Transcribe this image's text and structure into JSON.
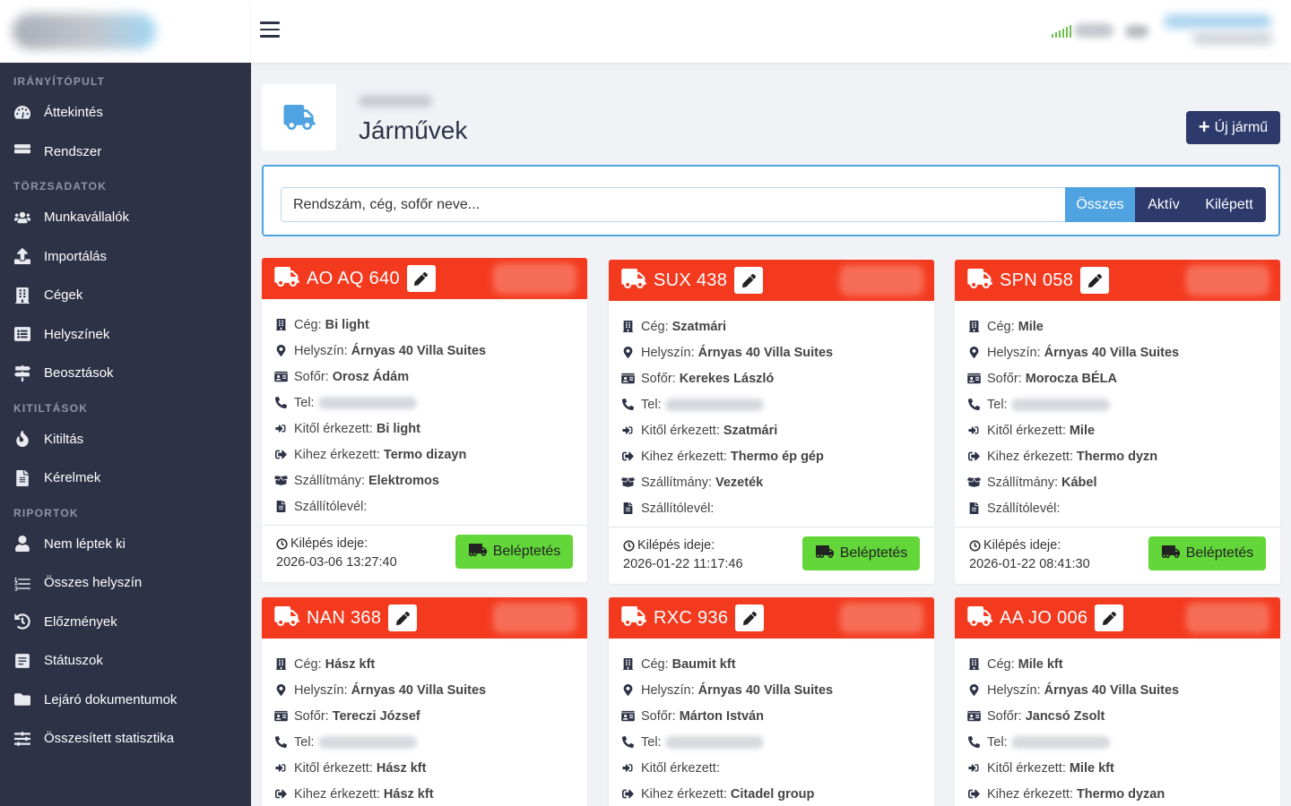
{
  "sidebar": {
    "sections": [
      {
        "title": "IRÁNYÍTÓPULT",
        "items": [
          {
            "label": "Áttekintés",
            "icon": "dashboard-icon"
          },
          {
            "label": "Rendszer",
            "icon": "server-icon"
          }
        ]
      },
      {
        "title": "TÖRZSADATOK",
        "items": [
          {
            "label": "Munkavállalók",
            "icon": "users-icon"
          },
          {
            "label": "Importálás",
            "icon": "upload-icon"
          },
          {
            "label": "Cégek",
            "icon": "building-icon"
          },
          {
            "label": "Helyszínek",
            "icon": "list-icon"
          },
          {
            "label": "Beosztások",
            "icon": "signs-icon"
          }
        ]
      },
      {
        "title": "KITILTÁSOK",
        "items": [
          {
            "label": "Kitiltás",
            "icon": "fire-icon"
          },
          {
            "label": "Kérelmek",
            "icon": "file-icon"
          }
        ]
      },
      {
        "title": "RIPORTOK",
        "items": [
          {
            "label": "Nem léptek ki",
            "icon": "user-report-icon"
          },
          {
            "label": "Összes helyszín",
            "icon": "ordered-list-icon"
          },
          {
            "label": "Előzmények",
            "icon": "history-icon"
          },
          {
            "label": "Státuszok",
            "icon": "status-icon"
          },
          {
            "label": "Lejáró dokumentumok",
            "icon": "folder-icon"
          },
          {
            "label": "Összesített statisztika",
            "icon": "sliders-icon"
          }
        ]
      }
    ]
  },
  "header": {
    "title": "Járművek",
    "new_button": "Új jármű"
  },
  "search": {
    "placeholder": "Rendszám, cég, sofőr neve...",
    "filters": [
      "Összes",
      "Aktív",
      "Kilépett"
    ],
    "active_filter": "Összes"
  },
  "labels": {
    "company": "Cég:",
    "location": "Helyszín:",
    "driver": "Sofőr:",
    "phone": "Tel:",
    "from": "Kitől érkezett:",
    "to": "Kihez érkezett:",
    "cargo": "Szállítmány:",
    "waybill": "Szállítólevél:",
    "exit_time": "Kilépés ideje:",
    "enter_button": "Beléptetés"
  },
  "colors": {
    "sidebar_bg": "#2d3246",
    "card_header": "#f33a1f",
    "accent_blue": "#4fa3e0",
    "navy": "#2d3a6b",
    "enter_green": "#63d63a"
  },
  "vehicles": [
    {
      "plate": "AO AQ 640",
      "company": "Bi light",
      "location": "Árnyas 40 Villa Suites",
      "driver": "Orosz Ádám",
      "from": "Bi light",
      "to": "Termo dizayn",
      "cargo": "Elektromos",
      "waybill": "",
      "exit_time": "2026-03-06 13:27:40"
    },
    {
      "plate": "SUX 438",
      "company": "Szatmári",
      "location": "Árnyas 40 Villa Suites",
      "driver": "Kerekes László",
      "from": "Szatmári",
      "to": "Thermo ép gép",
      "cargo": "Vezeték",
      "waybill": "",
      "exit_time": "2026-01-22 11:17:46"
    },
    {
      "plate": "SPN 058",
      "company": "Mile",
      "location": "Árnyas 40 Villa Suites",
      "driver": "Morocza BÉLA",
      "from": "Mile",
      "to": "Thermo dyzn",
      "cargo": "Kábel",
      "waybill": "",
      "exit_time": "2026-01-22 08:41:30"
    },
    {
      "plate": "NAN 368",
      "company": "Hász kft",
      "location": "Árnyas 40 Villa Suites",
      "driver": "Tereczi József",
      "from": "Hász kft",
      "to": "Hász kft"
    },
    {
      "plate": "RXC 936",
      "company": "Baumit kft",
      "location": "Árnyas 40 Villa Suites",
      "driver": "Márton István",
      "from": "",
      "to": "Citadel group"
    },
    {
      "plate": "AA JO 006",
      "company": "Mile kft",
      "location": "Árnyas 40 Villa Suites",
      "driver": "Jancsó Zsolt",
      "from": "Mile kft",
      "to": "Thermo dyzan"
    }
  ]
}
